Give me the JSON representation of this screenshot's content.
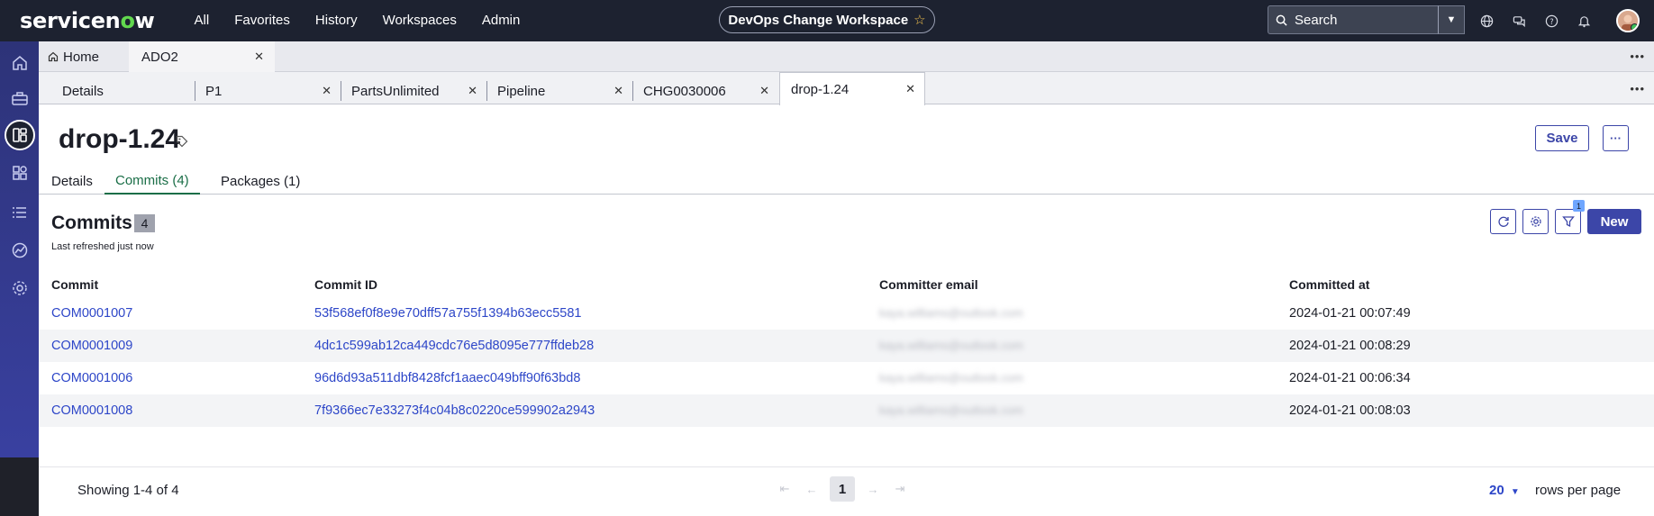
{
  "topnav": {
    "logo": "servicenow",
    "links": [
      "All",
      "Favorites",
      "History",
      "Workspaces",
      "Admin"
    ],
    "workspace": "DevOps Change Workspace",
    "search_placeholder": "Search"
  },
  "tabs_level1": [
    {
      "label": "Home",
      "active": false
    },
    {
      "label": "ADO2",
      "active": true
    }
  ],
  "tabs_level2": [
    {
      "label": "Details"
    },
    {
      "label": "P1"
    },
    {
      "label": "PartsUnlimited"
    },
    {
      "label": "Pipeline"
    },
    {
      "label": "CHG0030006"
    },
    {
      "label": "drop-1.24",
      "active": true
    }
  ],
  "record": {
    "title": "drop-1.24",
    "save_label": "Save",
    "more_label": "···"
  },
  "record_tabs": [
    "Details",
    "Commits (4)",
    "Packages (1)"
  ],
  "list": {
    "title": "Commits",
    "count": "4",
    "refreshed": "Last refreshed just now",
    "filter_count": "1",
    "new_label": "New",
    "columns": [
      "Commit",
      "Commit ID",
      "Committer email",
      "Committed at"
    ],
    "rows": [
      {
        "commit": "COM0001007",
        "commit_id": "53f568ef0f8e9e70dff57a755f1394b63ecc5581",
        "email": "kaya.williams@outlook.com",
        "committed_at": "2024-01-21 00:07:49"
      },
      {
        "commit": "COM0001009",
        "commit_id": "4dc1c599ab12ca449cdc76e5d8095e777ffdeb28",
        "email": "kaya.williams@outlook.com",
        "committed_at": "2024-01-21 00:08:29"
      },
      {
        "commit": "COM0001006",
        "commit_id": "96d6d93a511dbf8428fcf1aaec049bff90f63bd8",
        "email": "kaya.williams@outlook.com",
        "committed_at": "2024-01-21 00:06:34"
      },
      {
        "commit": "COM0001008",
        "commit_id": "7f9366ec7e33273f4c04b8c0220ce599902a2943",
        "email": "kaya.williams@outlook.com",
        "committed_at": "2024-01-21 00:08:03"
      }
    ]
  },
  "footer": {
    "showing": "Showing 1-4 of 4",
    "page": "1",
    "rows_per_page": "20",
    "rows_label": "rows per page"
  },
  "colors": {
    "primary": "#3c46a8",
    "link": "#2d46c8",
    "active_tab": "#1a6e47",
    "topnav": "#1d2230"
  }
}
